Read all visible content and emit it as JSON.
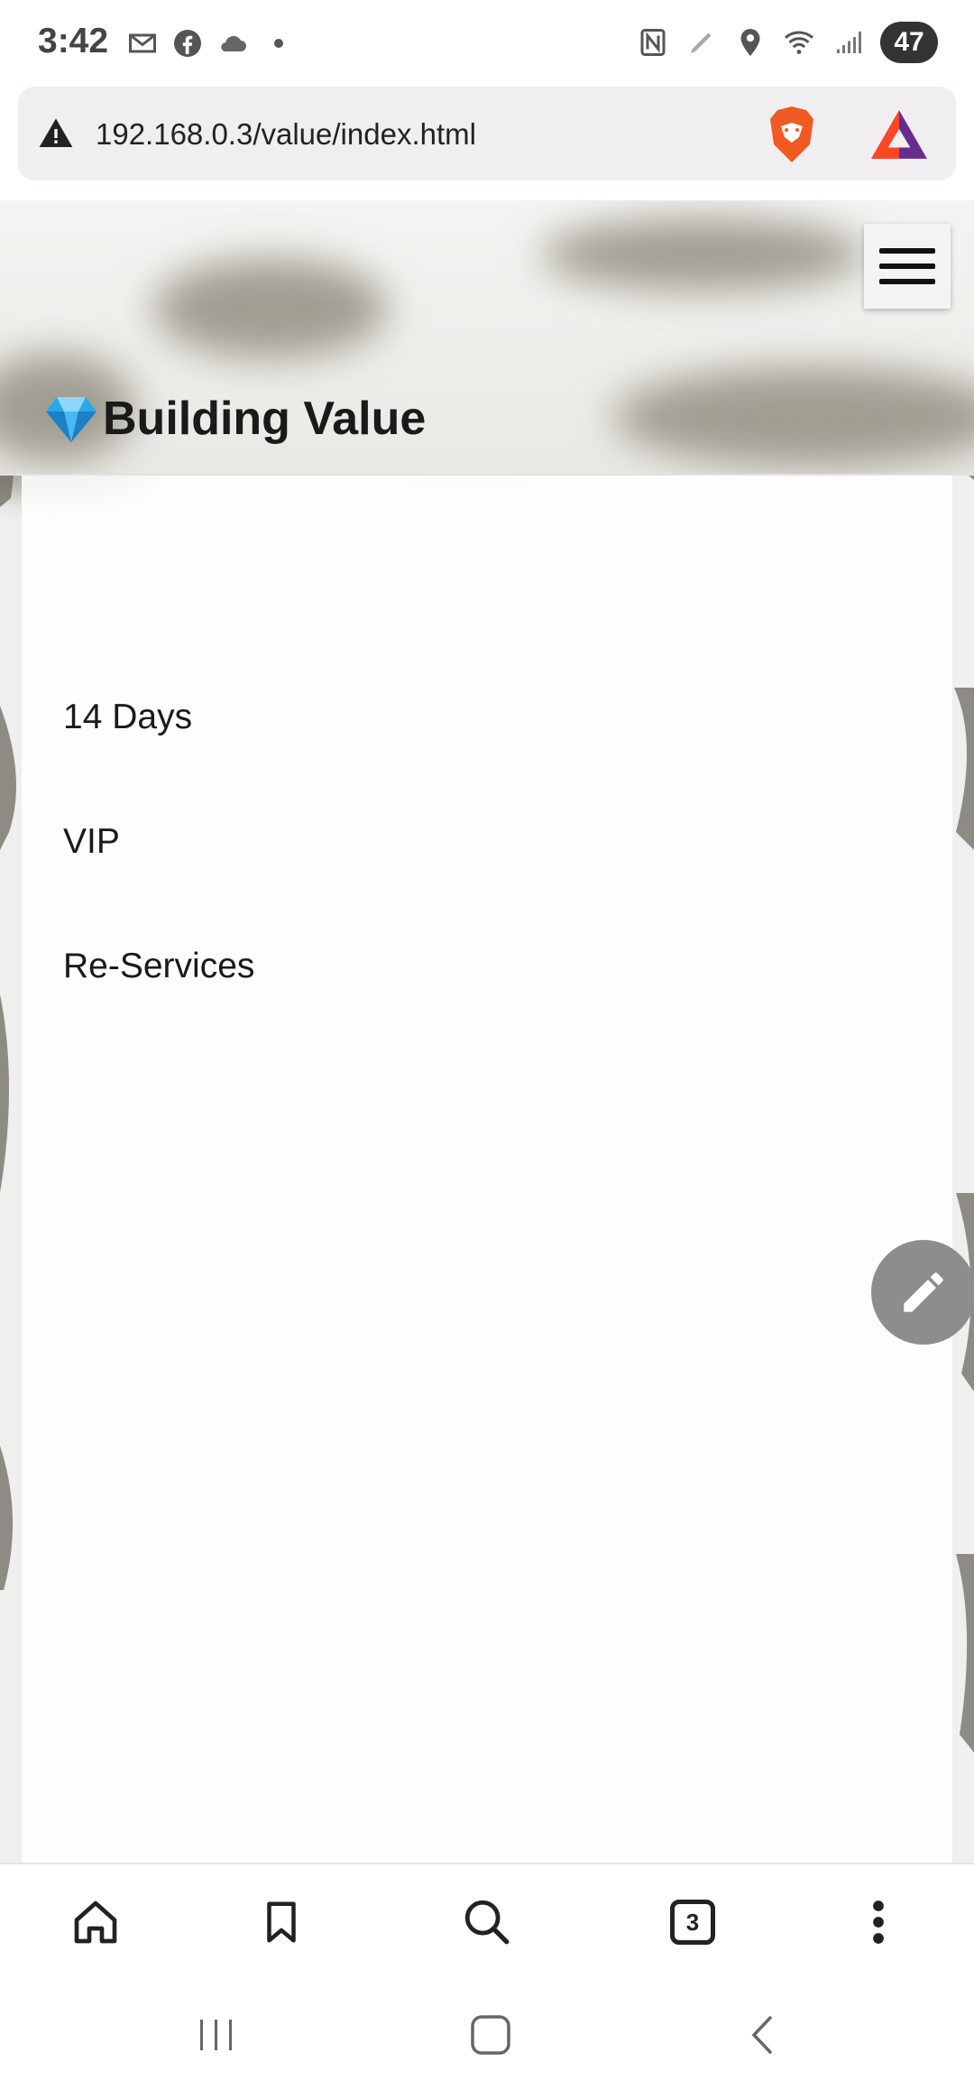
{
  "status_bar": {
    "time": "3:42",
    "battery": "47",
    "left_icons": [
      "gmail-icon",
      "facebook-icon",
      "cloud-icon",
      "dot-icon"
    ],
    "right_icons": [
      "nfc-icon",
      "pen-icon",
      "location-icon",
      "wifi-icon",
      "signal-icon",
      "battery-icon"
    ]
  },
  "browser": {
    "url": "192.168.0.3/value/index.html",
    "security_icon": "warning-triangle-icon",
    "shield_icon": "brave-lion-icon",
    "rewards_icon": "bat-triangle-icon"
  },
  "page": {
    "title": "Building Value",
    "title_icon": "gem-icon",
    "menu_icon": "hamburger-icon",
    "nav_items": [
      {
        "label": "14 Days"
      },
      {
        "label": "VIP"
      },
      {
        "label": "Re-Services"
      }
    ],
    "fab_icon": "pencil-icon"
  },
  "bottom_bar": {
    "items": [
      "home-icon",
      "bookmark-icon",
      "search-icon",
      "tabs-icon",
      "more-icon"
    ],
    "tab_count": "3"
  },
  "system_nav": [
    "recents-icon",
    "home-button-icon",
    "back-icon"
  ],
  "colors": {
    "fab": "#8d8d8d",
    "brave_orange": "#f15a22",
    "bat_purple": "#662d91"
  }
}
